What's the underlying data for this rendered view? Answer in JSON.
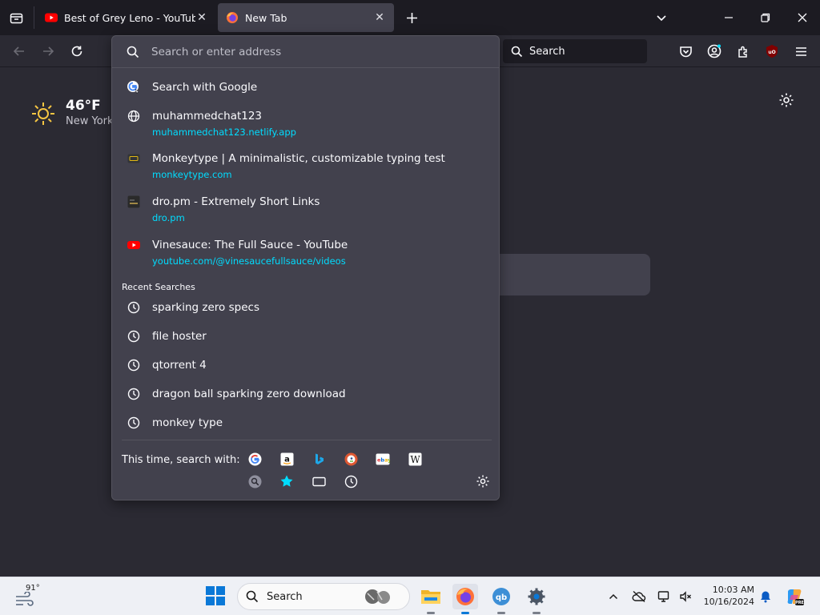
{
  "tabs": [
    {
      "title": "Best of Grey Leno - YouTube",
      "active": false
    },
    {
      "title": "New Tab",
      "active": true
    }
  ],
  "toolbar": {
    "search_placeholder": "Search"
  },
  "weather": {
    "temperature": "46°F",
    "city": "New York"
  },
  "urlbar": {
    "placeholder": "Search or enter address",
    "results": [
      {
        "title": "Search with Google",
        "url": "",
        "icon": "google-icon"
      },
      {
        "title": "muhammedchat123",
        "url": "muhammedchat123.netlify.app",
        "icon": "globe-icon"
      },
      {
        "title": "Monkeytype | A minimalistic, customizable typing test",
        "url": "monkeytype.com",
        "icon": "monkeytype-icon"
      },
      {
        "title": "dro.pm - Extremely Short Links",
        "url": "dro.pm",
        "icon": "dropm-icon"
      },
      {
        "title": "Vinesauce: The Full Sauce - YouTube",
        "url": "youtube.com/@vinesaucefullsauce/videos",
        "icon": "youtube-icon"
      }
    ],
    "recent_header": "Recent Searches",
    "recent_searches": [
      "sparking zero specs",
      "file hoster",
      "qtorrent 4",
      "dragon ball sparking zero download",
      "monkey type"
    ],
    "oneoff_label": "This time, search with:",
    "oneoff_engines": [
      "google",
      "amazon",
      "bing",
      "duckduckgo",
      "ebay",
      "wikipedia"
    ],
    "oneoff_modes": [
      "search-engines",
      "bookmarks",
      "tabs",
      "history"
    ]
  },
  "taskbar": {
    "weather_temp": "91°",
    "search_label": "Search",
    "time": "10:03 AM",
    "date": "10/16/2024"
  }
}
